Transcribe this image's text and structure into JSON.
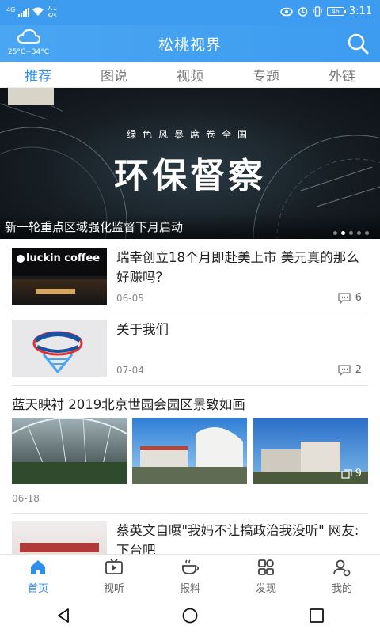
{
  "status_bar": {
    "network": "4G",
    "speed": "7.1",
    "speed_unit": "K/s",
    "battery": "46",
    "time": "3:11"
  },
  "header": {
    "title": "松桃视界",
    "weather_temp": "25°C~34°C"
  },
  "tabs": [
    {
      "label": "推荐",
      "active": true
    },
    {
      "label": "图说",
      "active": false
    },
    {
      "label": "视频",
      "active": false
    },
    {
      "label": "专题",
      "active": false
    },
    {
      "label": "外链",
      "active": false
    }
  ],
  "banner": {
    "subtitle": "绿色风暴席卷全国",
    "headline": "环保督察",
    "caption": "新一轮重点区域强化监督下月启动",
    "slide_count": 5,
    "active_slide": 2
  },
  "news": [
    {
      "title": "瑞幸创立18个月即赴美上市 美元真的那么好赚吗？",
      "image_text": "luckin coffee",
      "date": "06-05",
      "comments": "6"
    },
    {
      "title": "关于我们",
      "date": "07-04",
      "comments": "2"
    }
  ],
  "gallery": {
    "title": "蓝天映衬 2019北京世园会园区景致如画",
    "date": "06-18",
    "count": "9"
  },
  "partial_item": {
    "title": "蔡英文自曝\"我妈不让搞政治我没听\" 网友:下台吧"
  },
  "bottom_nav": [
    {
      "label": "首页",
      "icon": "home-icon",
      "active": true
    },
    {
      "label": "视听",
      "icon": "tv-icon",
      "active": false
    },
    {
      "label": "报料",
      "icon": "coffee-cup-icon",
      "active": false
    },
    {
      "label": "发现",
      "icon": "discover-icon",
      "active": false
    },
    {
      "label": "我的",
      "icon": "user-icon",
      "active": false
    }
  ],
  "colors": {
    "primary": "#3d9cf0",
    "tab_active": "#2f8ee8"
  }
}
